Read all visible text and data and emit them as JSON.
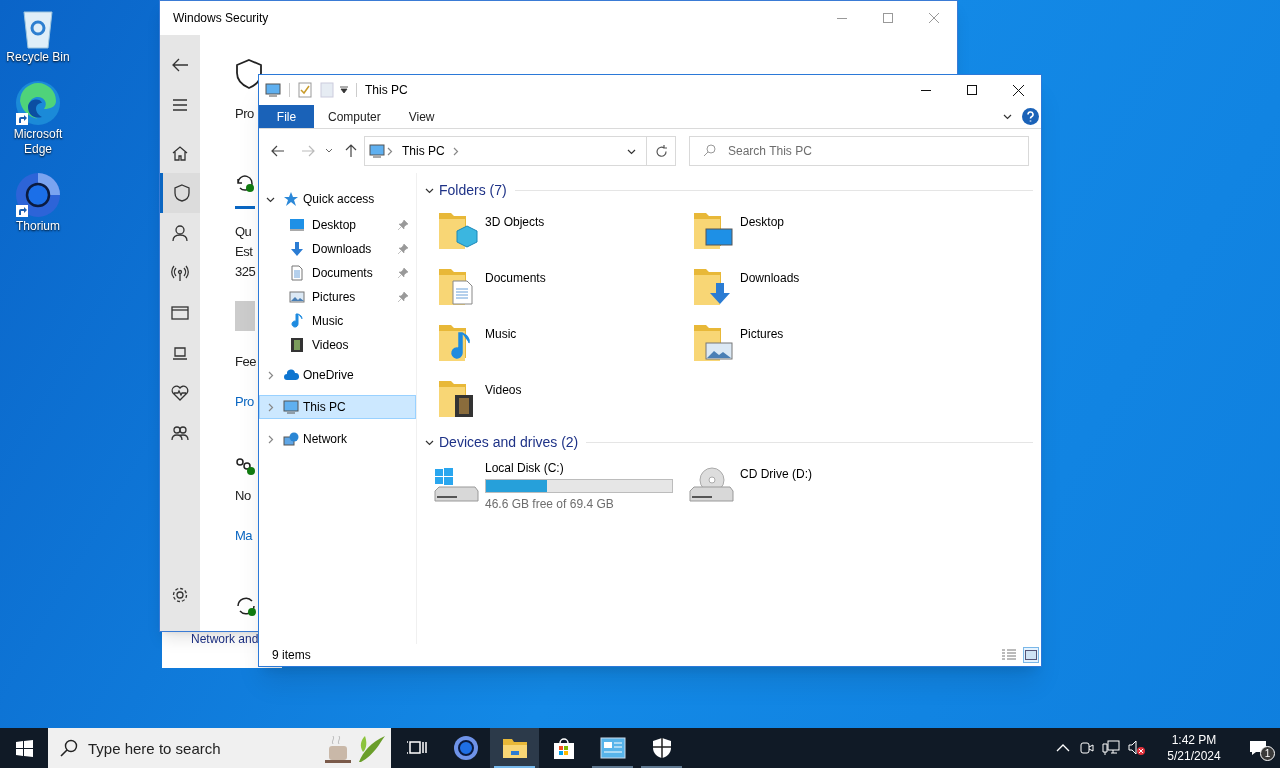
{
  "desktop_icons": [
    {
      "label": "Recycle Bin",
      "kind": "recycle",
      "shortcut": false
    },
    {
      "label": "Microsoft Edge",
      "kind": "edge",
      "shortcut": true
    },
    {
      "label": "Thorium",
      "kind": "thorium",
      "shortcut": true
    }
  ],
  "security": {
    "title": "Windows Security",
    "nav": [
      {
        "kind": "back"
      },
      {
        "kind": "menu"
      },
      {
        "kind": "home",
        "selected": false
      },
      {
        "kind": "shield",
        "selected": true
      },
      {
        "kind": "account",
        "selected": false
      },
      {
        "kind": "firewall",
        "selected": false
      },
      {
        "kind": "app",
        "selected": false
      },
      {
        "kind": "device",
        "selected": false
      },
      {
        "kind": "health",
        "selected": false
      },
      {
        "kind": "family",
        "selected": false
      },
      {
        "kind": "settings",
        "selected": false
      }
    ],
    "content": [
      {
        "kind": "text",
        "text": "Pro"
      },
      {
        "kind": "scan-icon"
      },
      {
        "kind": "text",
        "text": "Qu"
      },
      {
        "kind": "text",
        "text": "Est"
      },
      {
        "kind": "text",
        "text": "325"
      },
      {
        "kind": "button"
      },
      {
        "kind": "text",
        "text": "Fee"
      },
      {
        "kind": "link",
        "text": "Pro"
      },
      {
        "kind": "gear-icon"
      },
      {
        "kind": "text",
        "text": "No"
      },
      {
        "kind": "link",
        "text": "Ma"
      },
      {
        "kind": "update-icon"
      }
    ]
  },
  "behind_window": {
    "text": "Network and"
  },
  "explorer": {
    "title": "This PC",
    "ribbon_tabs": [
      {
        "label": "File",
        "kind": "file"
      },
      {
        "label": "Computer",
        "kind": "tab"
      },
      {
        "label": "View",
        "kind": "tab"
      }
    ],
    "address": "This PC",
    "search_placeholder": "Search This PC",
    "nav": [
      {
        "label": "Quick access",
        "kind": "star",
        "expanded": true,
        "selected": false,
        "children": [
          {
            "label": "Desktop",
            "kind": "desktop",
            "pinned": true
          },
          {
            "label": "Downloads",
            "kind": "downloads",
            "pinned": true
          },
          {
            "label": "Documents",
            "kind": "documents",
            "pinned": true
          },
          {
            "label": "Pictures",
            "kind": "pictures",
            "pinned": true
          },
          {
            "label": "Music",
            "kind": "music",
            "pinned": false
          },
          {
            "label": "Videos",
            "kind": "videos",
            "pinned": false
          }
        ]
      },
      {
        "label": "OneDrive",
        "kind": "cloud",
        "expanded": false,
        "selected": false
      },
      {
        "label": "This PC",
        "kind": "pc",
        "expanded": false,
        "selected": true
      },
      {
        "label": "Network",
        "kind": "network",
        "expanded": false,
        "selected": false
      }
    ],
    "groups": [
      {
        "title": "Folders (7)",
        "kind": "folders",
        "expanded": true,
        "items": [
          {
            "label": "3D Objects",
            "kind": "objects"
          },
          {
            "label": "Desktop",
            "kind": "desktop"
          },
          {
            "label": "Documents",
            "kind": "documents"
          },
          {
            "label": "Downloads",
            "kind": "downloads"
          },
          {
            "label": "Music",
            "kind": "music"
          },
          {
            "label": "Pictures",
            "kind": "pictures"
          },
          {
            "label": "Videos",
            "kind": "videos"
          }
        ]
      },
      {
        "title": "Devices and drives (2)",
        "kind": "drives",
        "expanded": true,
        "items": [
          {
            "label": "Local Disk (C:)",
            "kind": "disk",
            "level": 0.33,
            "reading": "46.6 GB free of 69.4 GB"
          },
          {
            "label": "CD Drive (D:)",
            "kind": "cd"
          }
        ]
      }
    ],
    "status": "9 items",
    "view_buttons": [
      {
        "kind": "details",
        "selected": false
      },
      {
        "kind": "large-icons",
        "selected": true
      }
    ]
  },
  "taskbar": {
    "search_placeholder": "Type here to search",
    "apps": [
      {
        "kind": "task-view",
        "selected": false,
        "running": false
      },
      {
        "kind": "thorium",
        "selected": false,
        "running": false
      },
      {
        "kind": "explorer",
        "selected": true,
        "running": true
      },
      {
        "kind": "store",
        "selected": false,
        "running": false
      },
      {
        "kind": "control",
        "selected": false,
        "running": true
      },
      {
        "kind": "security",
        "selected": false,
        "running": true
      }
    ],
    "time": "1:42 PM",
    "date": "5/21/2024",
    "notifications": "1"
  }
}
